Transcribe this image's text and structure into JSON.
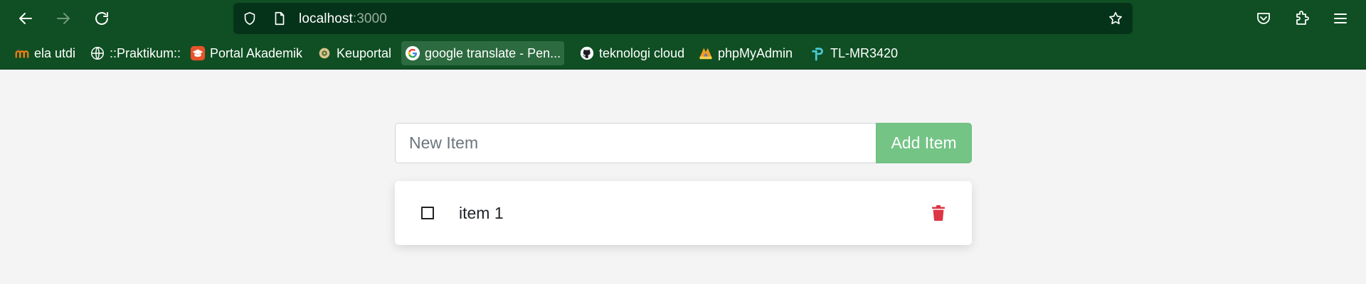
{
  "browser": {
    "url": {
      "host": "localhost",
      "port": ":3000"
    },
    "icons": {
      "back": "arrow-left-icon",
      "forward": "arrow-right-icon",
      "reload": "reload-icon",
      "security": "shield-icon",
      "page": "page-icon",
      "bookmark_star": "star-icon",
      "pocket": "pocket-icon",
      "extensions": "puzzle-icon",
      "menu": "hamburger-menu-icon"
    },
    "bookmarks": [
      {
        "label": "ela utdi",
        "icon": "moodle-icon"
      },
      {
        "label": "::Praktikum::",
        "icon": "globe-icon"
      },
      {
        "label": "Portal Akademik",
        "icon": "graduation-cap-icon"
      },
      {
        "label": "Keuportal",
        "icon": "gear-logo-icon"
      },
      {
        "label": "google translate - Pen...",
        "icon": "google-icon"
      },
      {
        "label": "teknologi cloud",
        "icon": "github-icon"
      },
      {
        "label": "phpMyAdmin",
        "icon": "phpmyadmin-icon"
      },
      {
        "label": "TL-MR3420",
        "icon": "tplink-icon"
      }
    ],
    "colors": {
      "toolbar": "#0f4f23",
      "urlbar": "#053319",
      "active_bookmark": "#2c6a3f"
    }
  },
  "app": {
    "input": {
      "placeholder": "New Item",
      "value": ""
    },
    "add_button": "Add Item",
    "items": [
      {
        "label": "item 1",
        "checked": false
      }
    ],
    "colors": {
      "add_button": "#74c486",
      "delete_icon": "#dc3545",
      "background": "#f4f4f4"
    }
  }
}
